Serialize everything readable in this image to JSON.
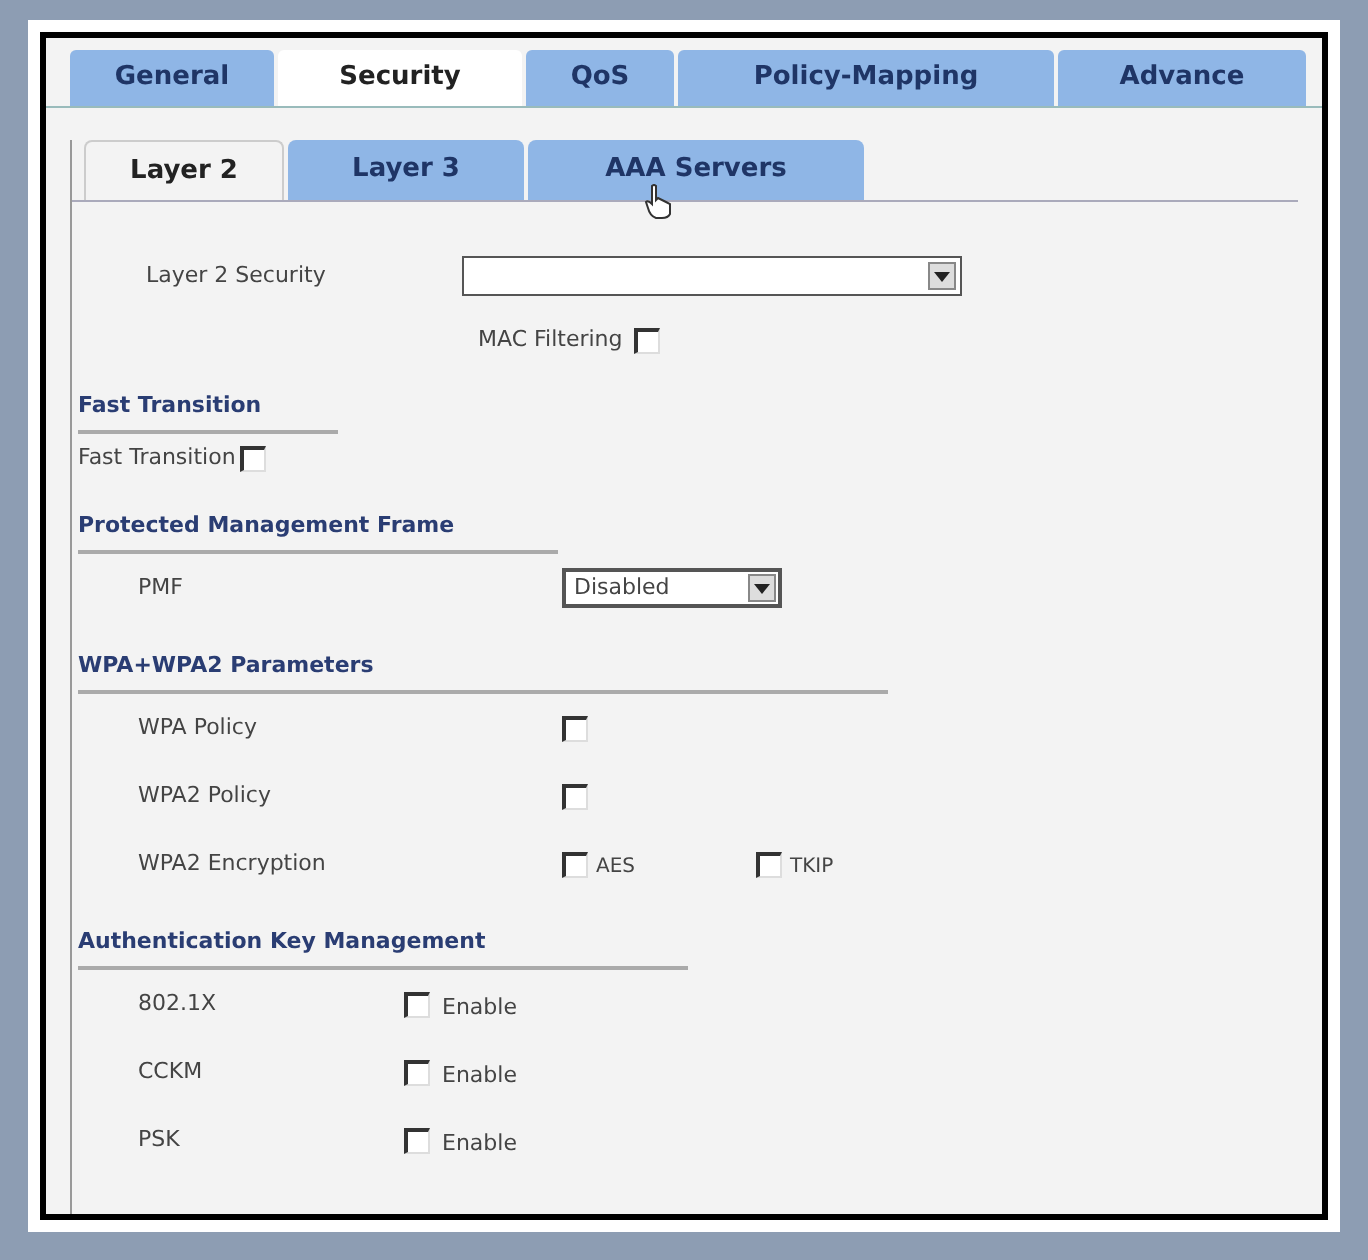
{
  "tabs": [
    {
      "label": "General",
      "selected": false
    },
    {
      "label": "Security",
      "selected": true
    },
    {
      "label": "QoS",
      "selected": false
    },
    {
      "label": "Policy-Mapping",
      "selected": false
    },
    {
      "label": "Advance",
      "selected": false
    }
  ],
  "subtabs": [
    {
      "label": "Layer 2",
      "selected": true
    },
    {
      "label": "Layer 3",
      "selected": false
    },
    {
      "label": "AAA Servers",
      "selected": false
    }
  ],
  "layer2_security": {
    "label": "Layer 2 Security"
  },
  "mac_filtering": {
    "label": "MAC Filtering",
    "checked": false
  },
  "sections": [
    {
      "title": "Fast Transition",
      "rows": [
        {
          "kind": "checkbox",
          "label": "Fast Transition",
          "checked": false
        }
      ]
    },
    {
      "title": "Protected Management Frame",
      "rows": [
        {
          "kind": "select",
          "label": "PMF",
          "value": "Disabled"
        }
      ]
    },
    {
      "title": "WPA+WPA2 Parameters",
      "rows": [
        {
          "kind": "checkbox",
          "label": "WPA Policy",
          "checked": false
        },
        {
          "kind": "checkbox",
          "label": "WPA2 Policy",
          "checked": false
        },
        {
          "kind": "options",
          "label": "WPA2 Encryption",
          "options": [
            {
              "label": "AES",
              "checked": false
            },
            {
              "label": "TKIP",
              "checked": false
            }
          ]
        }
      ]
    },
    {
      "title": "Authentication Key Management",
      "rows": [
        {
          "kind": "enable",
          "label": "802.1X",
          "option": "Enable",
          "checked": false
        },
        {
          "kind": "enable",
          "label": "CCKM",
          "option": "Enable",
          "checked": false
        },
        {
          "kind": "enable",
          "label": "PSK",
          "option": "Enable",
          "checked": false
        }
      ]
    }
  ]
}
